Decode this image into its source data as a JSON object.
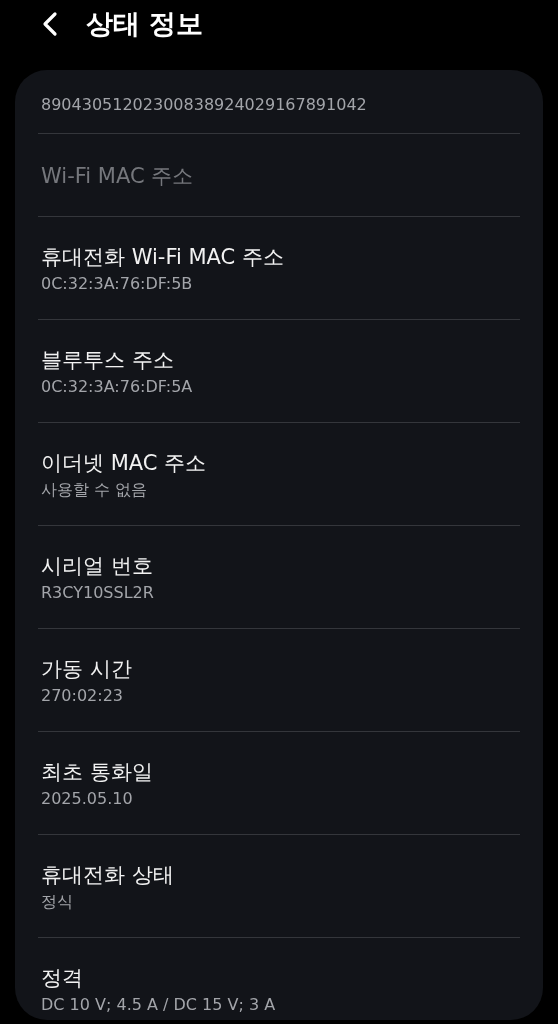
{
  "header": {
    "title": "상태 정보"
  },
  "items": [
    {
      "value": "89043051202300838924029167891042",
      "disabled": false
    },
    {
      "title": "Wi-Fi MAC 주소",
      "disabled": true
    },
    {
      "title": "휴대전화 Wi-Fi MAC 주소",
      "value": "0C:32:3A:76:DF:5B",
      "disabled": false
    },
    {
      "title": "블루투스 주소",
      "value": "0C:32:3A:76:DF:5A",
      "disabled": false
    },
    {
      "title": "이더넷 MAC 주소",
      "value": "사용할 수 없음",
      "disabled": false
    },
    {
      "title": "시리얼 번호",
      "value": "R3CY10SSL2R",
      "disabled": false
    },
    {
      "title": "가동 시간",
      "value": "270:02:23",
      "disabled": false
    },
    {
      "title": "최초 통화일",
      "value": "2025.05.10",
      "disabled": false
    },
    {
      "title": "휴대전화 상태",
      "value": "정식",
      "disabled": false
    },
    {
      "title": "정격",
      "value": "DC 10 V; 4.5 A / DC 15 V; 3 A",
      "disabled": false
    }
  ]
}
